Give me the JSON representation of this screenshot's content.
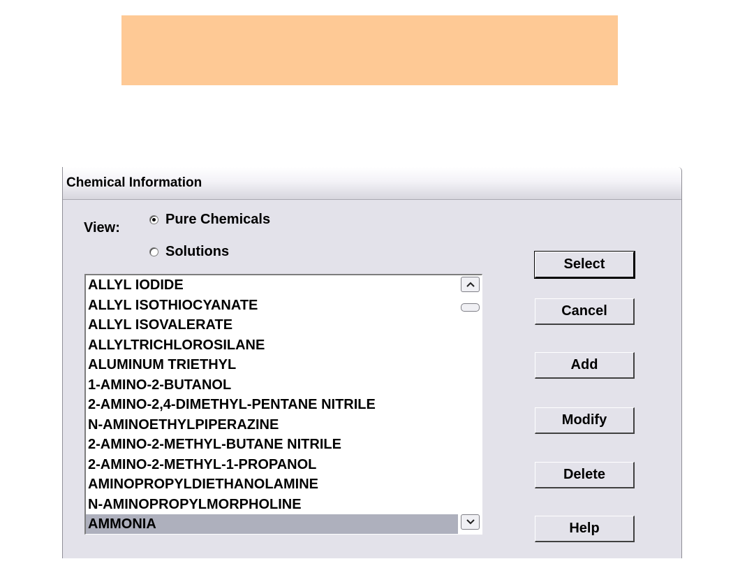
{
  "window": {
    "title": "Chemical Information"
  },
  "view": {
    "label": "View:",
    "options": [
      {
        "label": "Pure Chemicals",
        "selected": true
      },
      {
        "label": "Solutions",
        "selected": false
      }
    ]
  },
  "chemicals": {
    "items": [
      "ALLYL IODIDE",
      "ALLYL ISOTHIOCYANATE",
      "ALLYL ISOVALERATE",
      "ALLYLTRICHLOROSILANE",
      "ALUMINUM TRIETHYL",
      "1-AMINO-2-BUTANOL",
      "2-AMINO-2,4-DIMETHYL-PENTANE NITRILE",
      "N-AMINOETHYLPIPERAZINE",
      "2-AMINO-2-METHYL-BUTANE NITRILE",
      "2-AMINO-2-METHYL-1-PROPANOL",
      "AMINOPROPYLDIETHANOLAMINE",
      "N-AMINOPROPYLMORPHOLINE",
      "AMMONIA"
    ],
    "selected": "AMMONIA"
  },
  "buttons": {
    "select": "Select",
    "cancel": "Cancel",
    "add": "Add",
    "modify": "Modify",
    "delete": "Delete",
    "help": "Help"
  },
  "colors": {
    "banner": "#fec995",
    "dialog_bg": "#e3e2ea",
    "selection": "#aeb0bd"
  }
}
